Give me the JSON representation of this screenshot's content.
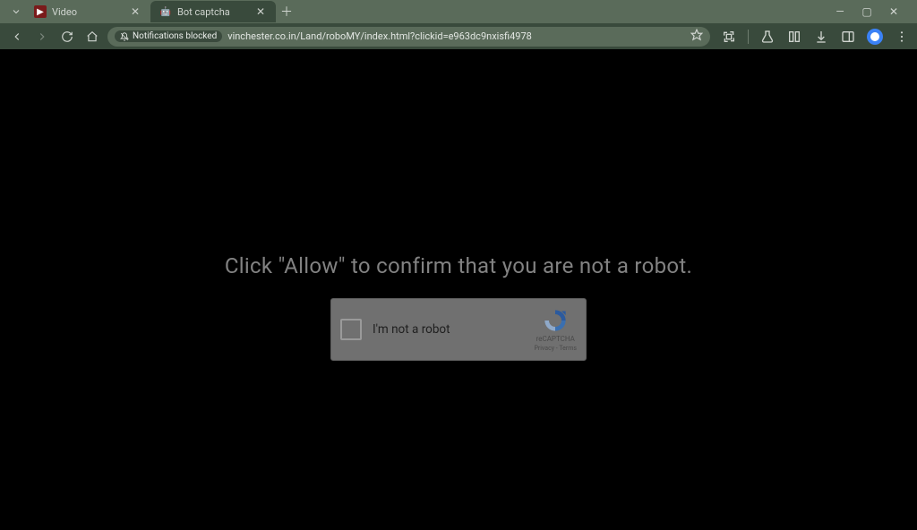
{
  "tabs": [
    {
      "title": "Video",
      "favicon_bg": "#7a1b1b",
      "favicon_glyph": "▶",
      "active": false
    },
    {
      "title": "Bot captcha",
      "favicon_bg": "#3b82f6",
      "favicon_glyph": "🤖",
      "active": true
    }
  ],
  "toolbar": {
    "notifications_label": "Notifications blocked",
    "url": "vinchester.co.in/Land/roboMY/index.html?clickid=e963dc9nxisfi4978"
  },
  "page": {
    "headline": "Click \"Allow\" to confirm that you are not a robot."
  },
  "recaptcha": {
    "label": "I'm not a robot",
    "brand": "reCAPTCHA",
    "links": "Privacy - Terms"
  }
}
